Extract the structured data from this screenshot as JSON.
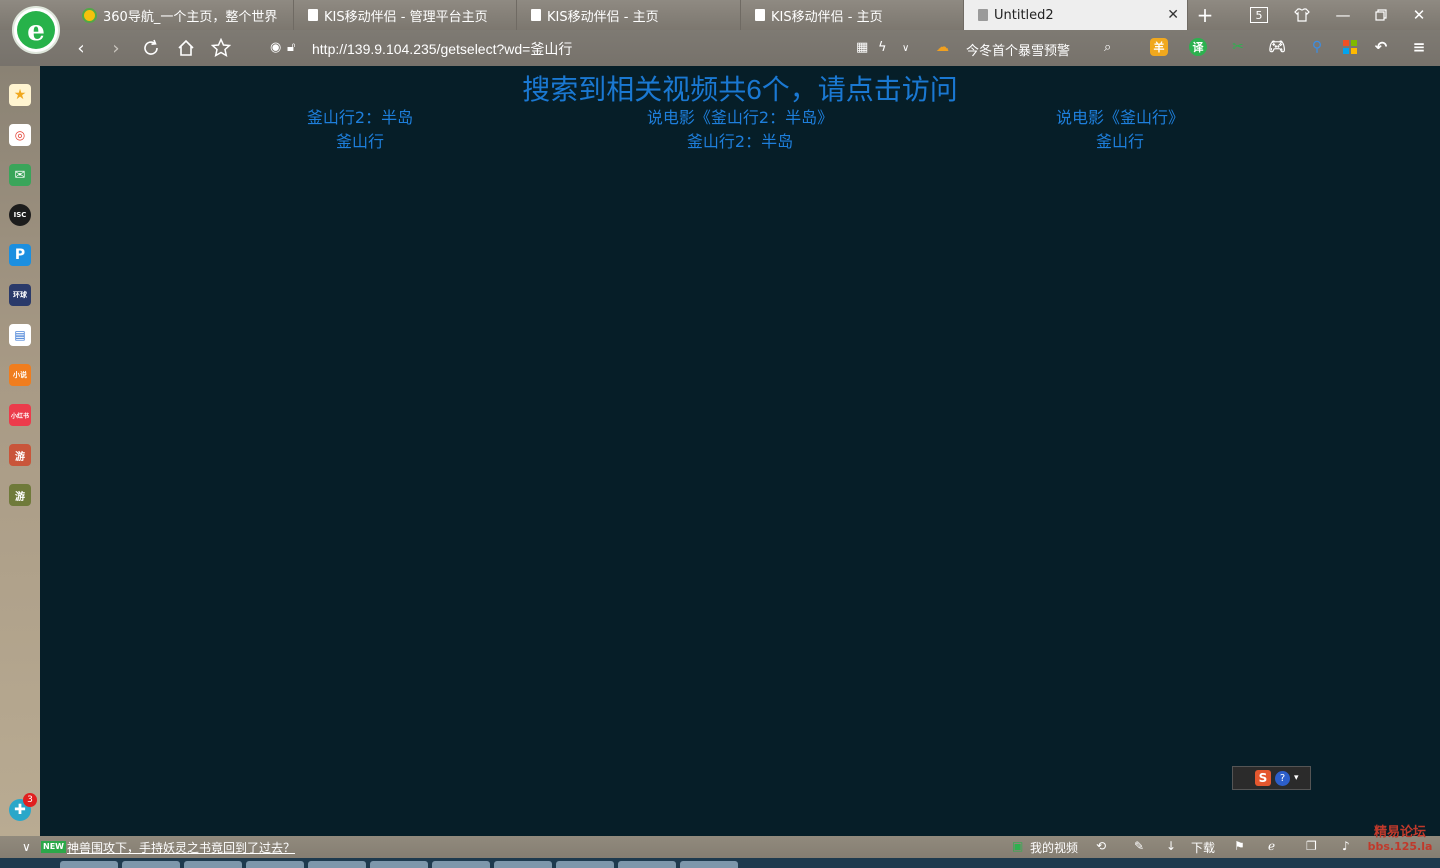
{
  "browser": {
    "tabs": [
      {
        "label": "360导航_一个主页，整个世界"
      },
      {
        "label": "KIS移动伴侣 - 管理平台主页"
      },
      {
        "label": "KIS移动伴侣 - 主页"
      },
      {
        "label": "KIS移动伴侣 - 主页"
      },
      {
        "label": "Untitled2"
      }
    ],
    "tab_count": "5",
    "url": "http://139.9.104.235/getselect?wd=釜山行",
    "news_ticker": "今冬首个暴雪预警",
    "ext_translate": "译"
  },
  "page": {
    "heading": "搜索到相关视频共6个，请点击访问",
    "videos": [
      {
        "title": "釜山行2：半岛"
      },
      {
        "title": "说电影《釜山行2：半岛》"
      },
      {
        "title": "说电影《釜山行》"
      },
      {
        "title": "釜山行"
      },
      {
        "title": "釜山行2：半岛"
      },
      {
        "title": "釜山行"
      }
    ]
  },
  "sidebar": {
    "badge": "3",
    "items": [
      {
        "icon": "star-icon",
        "color": "#f6c344"
      },
      {
        "icon": "weibo-icon",
        "color": "#e33b2e",
        "text": "微"
      },
      {
        "icon": "mail-icon",
        "color": "#3aa55a",
        "text": "✉"
      },
      {
        "icon": "isc-icon",
        "color": "#1c1c1c",
        "text": "ISC"
      },
      {
        "icon": "p-icon",
        "color": "#1b8fe0",
        "text": "P"
      },
      {
        "icon": "news-icon",
        "color": "#2a3a6a",
        "text": "环球"
      },
      {
        "icon": "word-icon",
        "color": "#2d6fd1",
        "text": "W"
      },
      {
        "icon": "novel-icon",
        "color": "#f07d1e",
        "text": "小说"
      },
      {
        "icon": "redbook-icon",
        "color": "#ec3b4b",
        "text": "小红书"
      },
      {
        "icon": "game-icon",
        "color": "#c9553a",
        "text": "游"
      },
      {
        "icon": "game2-icon",
        "color": "#6f7a3a",
        "text": "游"
      }
    ]
  },
  "statusbar": {
    "new_tag": "NEW",
    "news": "神兽围攻下，手持妖灵之书竟回到了过去？",
    "my_video": "我的视频",
    "download": "下载"
  },
  "watermark": {
    "line1": "精易论坛",
    "line2": "bbs.125.la"
  }
}
